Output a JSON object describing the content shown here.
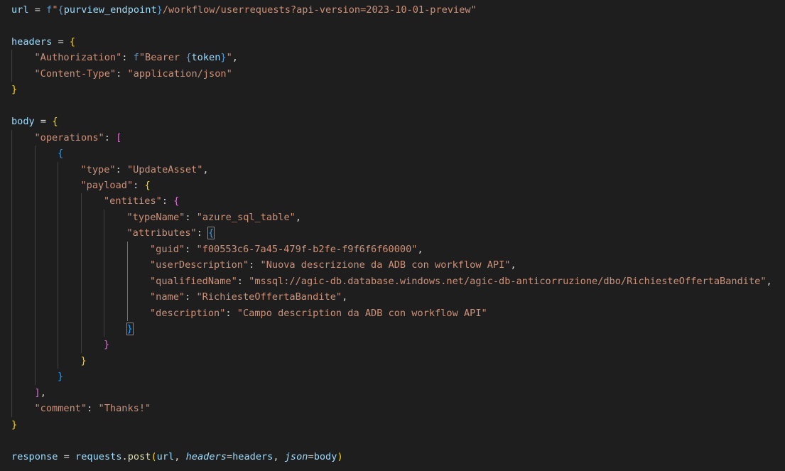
{
  "editor": {
    "lines": [
      {
        "indent": 0,
        "tokens": [
          {
            "c": "v",
            "t": "url"
          },
          {
            "c": "o",
            "t": " = "
          },
          {
            "c": "fp",
            "t": "f"
          },
          {
            "c": "s",
            "t": "\""
          },
          {
            "c": "fb",
            "t": "{"
          },
          {
            "c": "fi",
            "t": "purview_endpoint"
          },
          {
            "c": "fb",
            "t": "}"
          },
          {
            "c": "s",
            "t": "/workflow/userrequests?api-version=2023-10-01-preview\""
          }
        ]
      },
      {
        "indent": 0,
        "tokens": []
      },
      {
        "indent": 0,
        "tokens": [
          {
            "c": "v",
            "t": "headers"
          },
          {
            "c": "o",
            "t": " = "
          },
          {
            "c": "b1",
            "t": "{"
          }
        ]
      },
      {
        "indent": 1,
        "tokens": [
          {
            "c": "s",
            "t": "\"Authorization\""
          },
          {
            "c": "o",
            "t": ": "
          },
          {
            "c": "fp",
            "t": "f"
          },
          {
            "c": "s",
            "t": "\"Bearer "
          },
          {
            "c": "fb",
            "t": "{"
          },
          {
            "c": "fi",
            "t": "token"
          },
          {
            "c": "fb",
            "t": "}"
          },
          {
            "c": "s",
            "t": "\""
          },
          {
            "c": "o",
            "t": ","
          }
        ]
      },
      {
        "indent": 1,
        "tokens": [
          {
            "c": "s",
            "t": "\"Content-Type\""
          },
          {
            "c": "o",
            "t": ": "
          },
          {
            "c": "s",
            "t": "\"application/json\""
          }
        ]
      },
      {
        "indent": 0,
        "tokens": [
          {
            "c": "b1",
            "t": "}"
          }
        ]
      },
      {
        "indent": 0,
        "tokens": []
      },
      {
        "indent": 0,
        "tokens": [
          {
            "c": "v",
            "t": "body"
          },
          {
            "c": "o",
            "t": " = "
          },
          {
            "c": "b1",
            "t": "{"
          }
        ]
      },
      {
        "indent": 1,
        "tokens": [
          {
            "c": "s",
            "t": "\"operations\""
          },
          {
            "c": "o",
            "t": ": "
          },
          {
            "c": "b2",
            "t": "["
          }
        ]
      },
      {
        "indent": 2,
        "tokens": [
          {
            "c": "b3",
            "t": "{"
          }
        ]
      },
      {
        "indent": 3,
        "tokens": [
          {
            "c": "s",
            "t": "\"type\""
          },
          {
            "c": "o",
            "t": ": "
          },
          {
            "c": "s",
            "t": "\"UpdateAsset\""
          },
          {
            "c": "o",
            "t": ","
          }
        ]
      },
      {
        "indent": 3,
        "tokens": [
          {
            "c": "s",
            "t": "\"payload\""
          },
          {
            "c": "o",
            "t": ": "
          },
          {
            "c": "b1",
            "t": "{"
          }
        ]
      },
      {
        "indent": 4,
        "tokens": [
          {
            "c": "s",
            "t": "\"entities\""
          },
          {
            "c": "o",
            "t": ": "
          },
          {
            "c": "b2",
            "t": "{"
          }
        ]
      },
      {
        "indent": 5,
        "tokens": [
          {
            "c": "s",
            "t": "\"typeName\""
          },
          {
            "c": "o",
            "t": ": "
          },
          {
            "c": "s",
            "t": "\"azure_sql_table\""
          },
          {
            "c": "o",
            "t": ","
          }
        ]
      },
      {
        "indent": 5,
        "tokens": [
          {
            "c": "s",
            "t": "\"attributes\""
          },
          {
            "c": "o",
            "t": ": "
          },
          {
            "c": "b3 match",
            "t": "{"
          }
        ]
      },
      {
        "indent": 6,
        "tokens": [
          {
            "c": "s",
            "t": "\"guid\""
          },
          {
            "c": "o",
            "t": ": "
          },
          {
            "c": "s",
            "t": "\"f00553c6-7a45-479f-b2fe-f9f6f6f60000\""
          },
          {
            "c": "o",
            "t": ","
          }
        ]
      },
      {
        "indent": 6,
        "tokens": [
          {
            "c": "s",
            "t": "\"userDescription\""
          },
          {
            "c": "o",
            "t": ": "
          },
          {
            "c": "s",
            "t": "\"Nuova descrizione da ADB con workflow API\""
          },
          {
            "c": "o",
            "t": ","
          }
        ]
      },
      {
        "indent": 6,
        "tokens": [
          {
            "c": "s",
            "t": "\"qualifiedName\""
          },
          {
            "c": "o",
            "t": ": "
          },
          {
            "c": "s",
            "t": "\"mssql://agic-db.database.windows.net/agic-db-anticorruzione/dbo/RichiesteOffertaBandite\""
          },
          {
            "c": "o",
            "t": ","
          }
        ]
      },
      {
        "indent": 6,
        "tokens": [
          {
            "c": "s",
            "t": "\"name\""
          },
          {
            "c": "o",
            "t": ": "
          },
          {
            "c": "s",
            "t": "\"RichiesteOffertaBandite\""
          },
          {
            "c": "o",
            "t": ","
          }
        ]
      },
      {
        "indent": 6,
        "tokens": [
          {
            "c": "s",
            "t": "\"description\""
          },
          {
            "c": "o",
            "t": ": "
          },
          {
            "c": "s",
            "t": "\"Campo description da ADB con workflow API\""
          }
        ]
      },
      {
        "indent": 5,
        "tokens": [
          {
            "c": "b3 match",
            "t": "}"
          }
        ]
      },
      {
        "indent": 4,
        "tokens": [
          {
            "c": "b2",
            "t": "}"
          }
        ]
      },
      {
        "indent": 3,
        "tokens": [
          {
            "c": "b1",
            "t": "}"
          }
        ]
      },
      {
        "indent": 2,
        "tokens": [
          {
            "c": "b3",
            "t": "}"
          }
        ]
      },
      {
        "indent": 1,
        "tokens": [
          {
            "c": "b2",
            "t": "]"
          },
          {
            "c": "o",
            "t": ","
          }
        ]
      },
      {
        "indent": 1,
        "tokens": [
          {
            "c": "s",
            "t": "\"comment\""
          },
          {
            "c": "o",
            "t": ": "
          },
          {
            "c": "s",
            "t": "\"Thanks!\""
          }
        ]
      },
      {
        "indent": 0,
        "tokens": [
          {
            "c": "b1",
            "t": "}"
          }
        ]
      },
      {
        "indent": 0,
        "tokens": []
      },
      {
        "indent": 0,
        "tokens": [
          {
            "c": "v",
            "t": "response"
          },
          {
            "c": "o",
            "t": " = "
          },
          {
            "c": "v",
            "t": "requests"
          },
          {
            "c": "o",
            "t": "."
          },
          {
            "c": "fn",
            "t": "post"
          },
          {
            "c": "b1",
            "t": "("
          },
          {
            "c": "v",
            "t": "url"
          },
          {
            "c": "o",
            "t": ", "
          },
          {
            "c": "pm",
            "t": "headers"
          },
          {
            "c": "o",
            "t": "="
          },
          {
            "c": "v",
            "t": "headers"
          },
          {
            "c": "o",
            "t": ", "
          },
          {
            "c": "pm",
            "t": "json"
          },
          {
            "c": "o",
            "t": "="
          },
          {
            "c": "v",
            "t": "body"
          },
          {
            "c": "b1",
            "t": ")"
          }
        ]
      }
    ]
  }
}
